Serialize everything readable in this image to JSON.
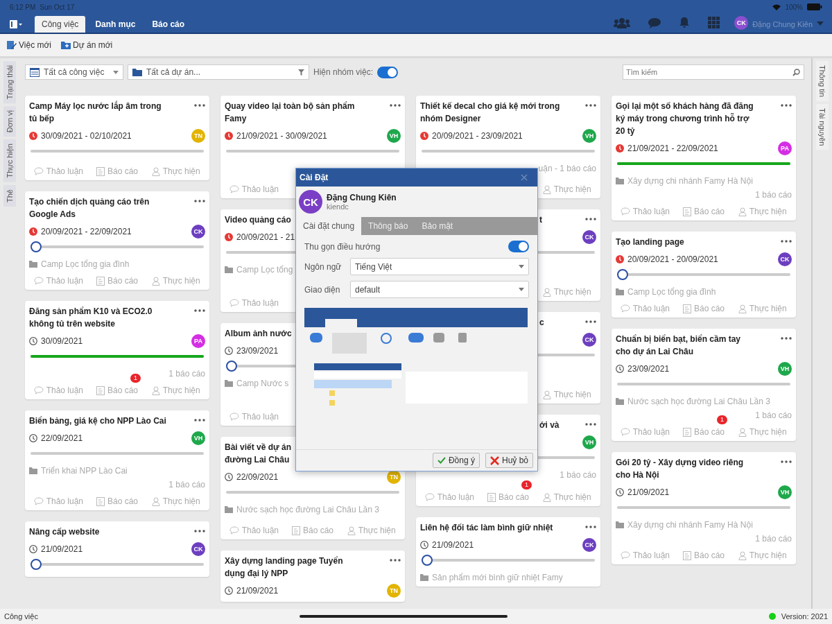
{
  "status_bar": {
    "time": "6:12 PM",
    "date": "Sun Oct 17",
    "battery": "100%"
  },
  "nav": {
    "tabs": [
      {
        "label": "Công việc",
        "selected": true
      },
      {
        "label": "Danh mục",
        "selected": false
      },
      {
        "label": "Báo cáo",
        "selected": false
      }
    ],
    "user": {
      "initials": "CK",
      "name": "Đặng Chung Kiên"
    }
  },
  "toolbar": [
    {
      "kind": "task",
      "label": "Việc mới"
    },
    {
      "kind": "project",
      "label": "Dự án mới"
    }
  ],
  "left_tabs": [
    "Trạng thái",
    "Đơn vị",
    "Thực hiện",
    "Thẻ"
  ],
  "right_tabs": [
    "Thông tin",
    "Tài nguyên"
  ],
  "filters": {
    "task_filter": "Tất cả công việc",
    "project_filter": "Tất cả dự án...",
    "group_toggle": {
      "label": "Hiện nhóm việc:",
      "on": true
    },
    "search": {
      "placeholder": "Tìm kiếm"
    }
  },
  "columns": [
    {
      "cards": [
        {
          "kind": "full",
          "title": [
            "Camp Máy lọc nước lắp âm trong",
            "tủ bếp"
          ],
          "date": "30/09/2021 - 02/10/2021",
          "overdue": true,
          "avatar": {
            "initials": "TN",
            "color": "#e2b400"
          },
          "progress": {
            "level": 0,
            "handle": false
          },
          "actions": [
            {
              "kind": "discuss",
              "label": "Thảo luận"
            },
            {
              "kind": "report",
              "label": "Báo cáo"
            },
            {
              "kind": "assign",
              "label": "Thực hiện"
            }
          ]
        },
        {
          "kind": "full",
          "title": [
            "Tạo chiến dịch quảng cáo trên",
            "Google Ads"
          ],
          "date": "20/09/2021 - 22/09/2021",
          "overdue": true,
          "avatar": {
            "initials": "CK",
            "color": "#6d3fc0"
          },
          "progress": {
            "level": 0,
            "handle": true
          },
          "project": "Camp Lọc tổng gia đình",
          "actions": [
            {
              "kind": "discuss",
              "label": "Thảo luận"
            },
            {
              "kind": "report",
              "label": "Báo cáo"
            },
            {
              "kind": "assign",
              "label": "Thực hiện"
            }
          ]
        },
        {
          "kind": "full",
          "title": [
            "Đăng sản phẩm K10 và ECO2.0",
            "không tủ trên website"
          ],
          "date": "30/09/2021",
          "overdue": false,
          "avatar": {
            "initials": "PA",
            "color": "#d42ee4"
          },
          "progress": {
            "level": 1,
            "handle": false
          },
          "counts": "1 báo cáo",
          "actions": [
            {
              "kind": "discuss",
              "label": "Thảo luận"
            },
            {
              "kind": "report",
              "label": "Báo cáo",
              "badge": "1"
            },
            {
              "kind": "assign",
              "label": "Thực hiện"
            }
          ]
        },
        {
          "kind": "full",
          "title": [
            "Biển bảng, giá kệ cho NPP Lào Cai"
          ],
          "date": "22/09/2021",
          "overdue": false,
          "avatar": {
            "initials": "VH",
            "color": "#1ea84c"
          },
          "progress": {
            "level": 0,
            "handle": false
          },
          "project": "Triển khai NPP Lào Cai",
          "counts": "1 báo cáo",
          "actions": [
            {
              "kind": "discuss",
              "label": "Thảo luận"
            },
            {
              "kind": "report",
              "label": "Báo cáo"
            },
            {
              "kind": "assign",
              "label": "Thực hiện"
            }
          ]
        },
        {
          "kind": "full",
          "title": [
            "Nâng cấp website"
          ],
          "date": "21/09/2021",
          "overdue": false,
          "avatar": {
            "initials": "CK",
            "color": "#6d3fc0"
          },
          "progress": {
            "level": 0,
            "handle": true
          }
        }
      ]
    },
    {
      "cards": [
        {
          "kind": "bottom",
          "title": [
            "Quay video lại toàn bộ sản phẩm",
            "Famy"
          ],
          "date": "21/09/2021 - 30/09/2021",
          "overdue": true,
          "avatar": {
            "initials": "VH",
            "color": "#1ea84c"
          },
          "progress": {
            "level": 0,
            "handle": false
          },
          "actions": [
            {
              "kind": "discuss",
              "label": "Thảo luận"
            }
          ]
        },
        {
          "kind": "left",
          "title": [
            "Video quảng cáo"
          ],
          "date": "20/09/2021 - 21",
          "overdue": true,
          "progress": {
            "level": 0,
            "handle": false
          },
          "project": "Camp Lọc tổng",
          "actions": [
            {
              "kind": "discuss",
              "label": "Thảo luận"
            }
          ]
        },
        {
          "kind": "left",
          "title": [
            "Album ảnh nước"
          ],
          "date": "23/09/2021",
          "overdue": false,
          "progress": {
            "level": 0,
            "handle": true
          },
          "project": "Camp Nước s",
          "actions": [
            {
              "kind": "discuss",
              "label": "Thảo luận"
            }
          ]
        },
        {
          "kind": "left",
          "title": [
            "Bài viết về dự án",
            "đường Lai Châu"
          ],
          "date": "22/09/2021",
          "overdue": false,
          "avatar": {
            "initials": "TN",
            "color": "#e2b400"
          },
          "progress": {
            "level": 0,
            "handle": false
          },
          "project": "Nước sạch học đường Lai Châu Lần 3",
          "actions": [
            {
              "kind": "discuss",
              "label": "Thảo luận"
            },
            {
              "kind": "report",
              "label": "Báo cáo"
            },
            {
              "kind": "assign",
              "label": "Thực hiện"
            }
          ]
        },
        {
          "kind": "full",
          "title": [
            "Xây dựng landing page Tuyển",
            "dụng đại lý NPP"
          ],
          "date": "21/09/2021",
          "overdue": false,
          "avatar": {
            "initials": "TN",
            "color": "#e2b400"
          }
        }
      ]
    },
    {
      "cards": [
        {
          "kind": "bottom",
          "title": [
            "Thiết kế decal cho giá kệ mới trong",
            "nhóm Designer"
          ],
          "date": "20/09/2021 - 23/09/2021",
          "overdue": true,
          "avatar": {
            "initials": "VH",
            "color": "#1ea84c"
          },
          "progress": {
            "level": 0,
            "handle": false
          },
          "counts": "uận - 1 báo cáo",
          "actions": [
            {
              "kind": "assign",
              "label": "Thực hiện"
            }
          ]
        },
        {
          "kind": "right",
          "title": [
            "t"
          ],
          "avatar": {
            "initials": "CK",
            "color": "#6d3fc0"
          },
          "progress": {
            "level": 0
          },
          "actions": [
            {
              "kind": "assign",
              "label": "Thực hiện"
            }
          ]
        },
        {
          "kind": "right",
          "title": [
            "c"
          ],
          "avatar": {
            "initials": "CK",
            "color": "#6d3fc0"
          },
          "progress": {
            "level": 0
          },
          "actions": [
            {
              "kind": "assign",
              "label": "Thực hiện"
            }
          ]
        },
        {
          "kind": "right",
          "title": [
            "ới và"
          ],
          "avatar": {
            "initials": "VH",
            "color": "#1ea84c"
          },
          "progress": {
            "level": 0
          },
          "counts": "1 báo cáo",
          "actions": [
            {
              "kind": "discuss",
              "label": "Thảo luận"
            },
            {
              "kind": "report",
              "label": "Báo cáo",
              "badge": "1"
            },
            {
              "kind": "assign",
              "label": "Thực hiện"
            }
          ]
        },
        {
          "kind": "full",
          "title": [
            "Liên hệ đối tác làm bình giữ nhiệt"
          ],
          "date": "21/09/2021",
          "overdue": false,
          "avatar": {
            "initials": "CK",
            "color": "#6d3fc0"
          },
          "progress": {
            "level": 0,
            "handle": true
          },
          "project": "Sản phẩm mới bình giữ nhiệt Famy"
        }
      ]
    },
    {
      "cards": [
        {
          "kind": "full",
          "title": [
            "Gọi lại một số khách hàng đã đăng",
            "ký máy trong chương trình hỗ trợ",
            "20 tỷ"
          ],
          "date": "21/09/2021 - 22/09/2021",
          "overdue": true,
          "avatar": {
            "initials": "PA",
            "color": "#d42ee4"
          },
          "progress": {
            "level": 1,
            "handle": false
          },
          "project": "Xây dựng chi nhánh Famy Hà Nội",
          "counts": "1 báo cáo",
          "actions": [
            {
              "kind": "discuss",
              "label": "Thảo luận"
            },
            {
              "kind": "report",
              "label": "Báo cáo"
            },
            {
              "kind": "assign",
              "label": "Thực hiện"
            }
          ]
        },
        {
          "kind": "full",
          "title": [
            "Tạo landing page"
          ],
          "date": "20/09/2021 - 20/09/2021",
          "overdue": true,
          "avatar": {
            "initials": "CK",
            "color": "#6d3fc0"
          },
          "progress": {
            "level": 0,
            "handle": true
          },
          "project": "Camp Lọc tổng gia đình",
          "actions": [
            {
              "kind": "discuss",
              "label": "Thảo luận"
            },
            {
              "kind": "report",
              "label": "Báo cáo"
            },
            {
              "kind": "assign",
              "label": "Thực hiện"
            }
          ]
        },
        {
          "kind": "full",
          "title": [
            "Chuẩn bị biển bạt, biển cầm tay",
            "cho dự án Lai Châu"
          ],
          "date": "23/09/2021",
          "overdue": false,
          "avatar": {
            "initials": "VH",
            "color": "#1ea84c"
          },
          "progress": {
            "level": 0,
            "handle": false
          },
          "project": "Nước sạch học đường Lai Châu Lần 3",
          "counts": "1 báo cáo",
          "actions": [
            {
              "kind": "discuss",
              "label": "Thảo luận"
            },
            {
              "kind": "report",
              "label": "Báo cáo",
              "badge": "1"
            },
            {
              "kind": "assign",
              "label": "Thực hiện"
            }
          ]
        },
        {
          "kind": "full",
          "title": [
            "Gói 20 tỷ - Xây dựng video riêng",
            "cho Hà Nội"
          ],
          "date": "21/09/2021",
          "overdue": false,
          "avatar": {
            "initials": "VH",
            "color": "#1ea84c"
          },
          "progress": {
            "level": 0,
            "handle": false
          },
          "project": "Xây dựng chi nhánh Famy Hà Nội",
          "counts": "1 báo cáo",
          "actions": [
            {
              "kind": "discuss",
              "label": "Thảo luận"
            },
            {
              "kind": "report",
              "label": "Báo cáo"
            },
            {
              "kind": "assign",
              "label": "Thực hiện"
            }
          ]
        }
      ]
    }
  ],
  "dialog": {
    "title": "Cài Đặt",
    "user": {
      "initials": "CK",
      "name": "Đặng Chung Kiên",
      "login": "kiendc"
    },
    "tabs": [
      {
        "label": "Cài đặt chung",
        "selected": true
      },
      {
        "label": "Thông báo",
        "selected": false
      },
      {
        "label": "Bảo mật",
        "selected": false
      }
    ],
    "collapse_nav": {
      "label": "Thu gọn điều hướng",
      "on": true
    },
    "fields": [
      {
        "label": "Ngôn ngữ",
        "value": "Tiếng Việt"
      },
      {
        "label": "Giao diện",
        "value": "default"
      }
    ],
    "buttons": [
      {
        "kind": "ok",
        "label": "Đồng ý"
      },
      {
        "kind": "cancel",
        "label": "Huỷ bỏ"
      }
    ]
  },
  "footer": {
    "label": "Công việc",
    "online": true,
    "version": "Version: 2021"
  }
}
